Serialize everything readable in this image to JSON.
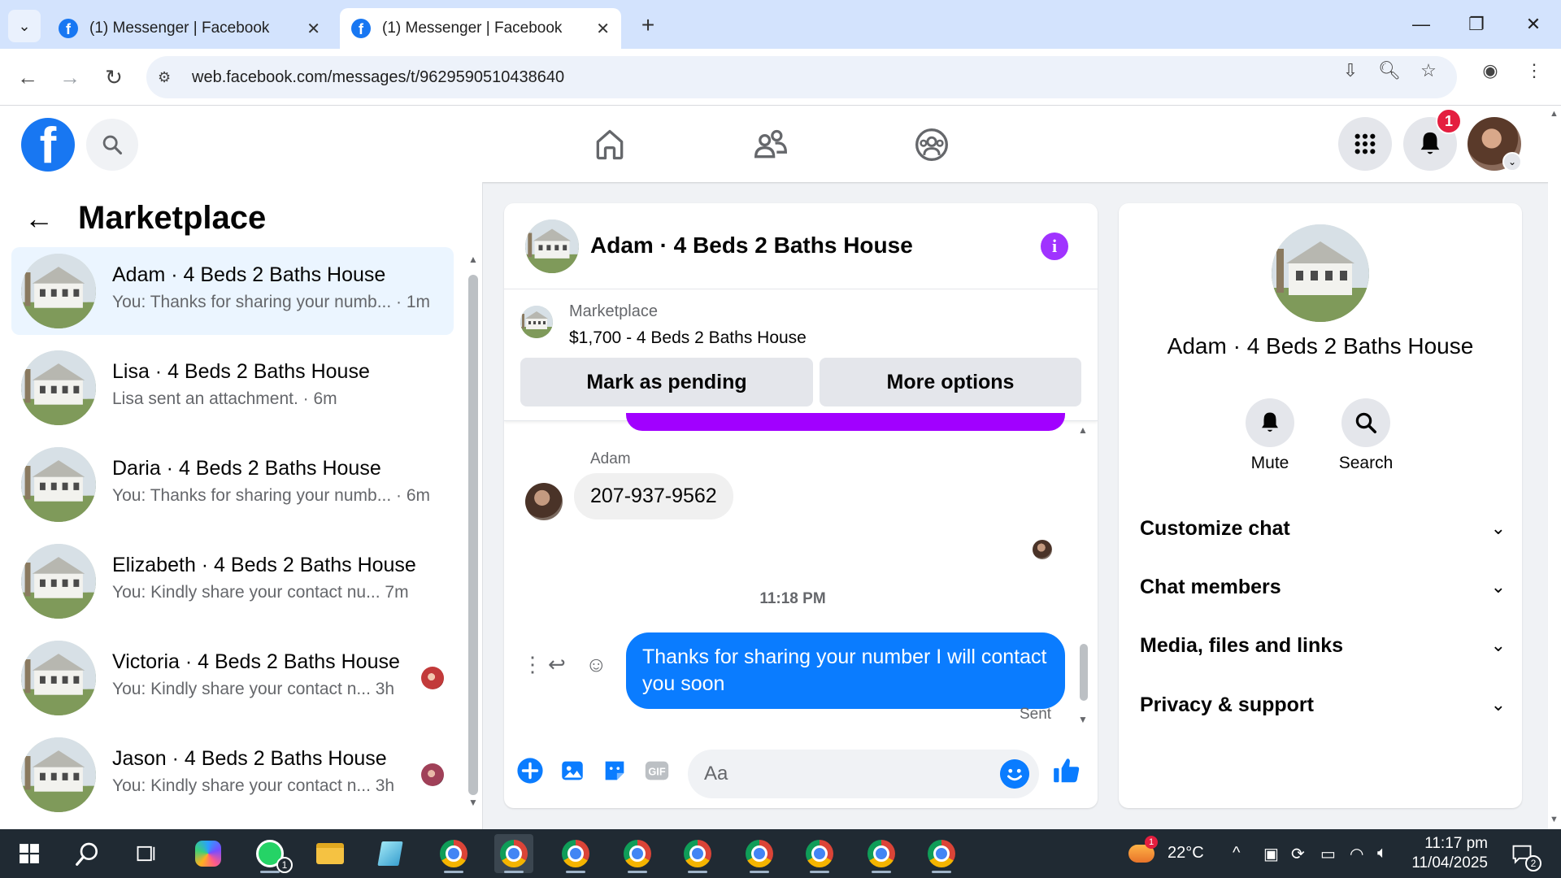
{
  "browser": {
    "tabs": [
      {
        "title": "(1) Messenger | Facebook",
        "active": false
      },
      {
        "title": "(1) Messenger | Facebook",
        "active": true
      }
    ],
    "new_tab": "+",
    "url": "web.facebook.com/messages/t/9629590510438640"
  },
  "header": {
    "notification_count": "1"
  },
  "sidebar": {
    "title": "Marketplace",
    "conversations": [
      {
        "name": "Adam · 4 Beds 2 Baths House",
        "preview": "You: Thanks for sharing your numb... · 1m",
        "selected": true
      },
      {
        "name": "Lisa · 4 Beds 2 Baths House",
        "preview": "Lisa sent an attachment. · 6m"
      },
      {
        "name": "Daria · 4 Beds 2 Baths House",
        "preview": "You: Thanks for sharing your numb... · 6m"
      },
      {
        "name": "Elizabeth · 4 Beds 2 Baths House",
        "preview": "You: Kindly share your contact nu...   7m"
      },
      {
        "name": "Victoria · 4 Beds 2 Baths House",
        "preview": "You: Kindly share your contact n...   3h"
      },
      {
        "name": "Jason · 4 Beds 2 Baths House",
        "preview": "You: Kindly share your contact n...   3h"
      }
    ]
  },
  "chat": {
    "title": "Adam · 4 Beds 2 Baths House",
    "info": "i",
    "listing_label": "Marketplace",
    "listing_price": "$1,700 - 4 Beds 2 Baths House",
    "mark_pending": "Mark as pending",
    "more_options": "More options",
    "sender_name": "Adam",
    "incoming_message": "207-937-9562",
    "timestamp": "11:18 PM",
    "outgoing_message": "Thanks for sharing your number I will contact you soon",
    "status": "Sent",
    "composer_placeholder": "Aa"
  },
  "panel": {
    "name": "Adam · 4 Beds 2 Baths House",
    "mute": "Mute",
    "search": "Search",
    "sections": [
      "Customize chat",
      "Chat members",
      "Media, files and links",
      "Privacy & support"
    ]
  },
  "taskbar": {
    "weather": "22°C",
    "weather_badge": "1",
    "whatsapp_badge": "1",
    "time": "11:17 pm",
    "date": "11/04/2025",
    "notif_count": "2"
  },
  "colors": {
    "fb_blue": "#1877f2",
    "messenger_blue": "#0a7cff",
    "info_purple": "#a033ff"
  }
}
